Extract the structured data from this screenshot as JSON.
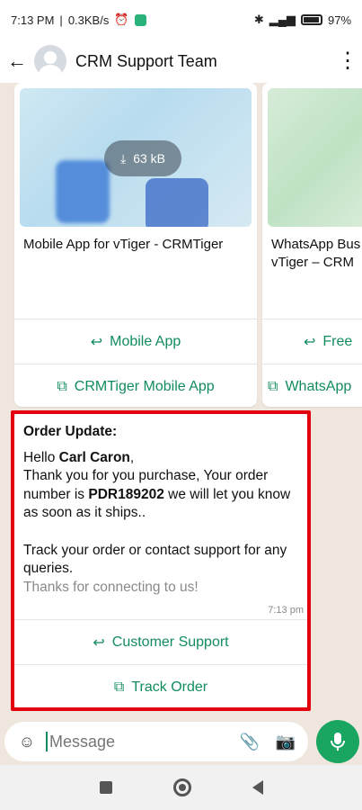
{
  "status": {
    "time": "7:13 PM",
    "speed": "0.3KB/s",
    "alarm_icon": "alarm-icon",
    "battery": "97"
  },
  "header": {
    "title": "CRM Support Team"
  },
  "cards": [
    {
      "size_label": "63 kB",
      "text": "Mobile App for vTiger - CRMTiger",
      "reply_button": "Mobile App",
      "link_button": "CRMTiger Mobile App"
    },
    {
      "text": "WhatsApp Bus for vTiger – CRM",
      "reply_button": "Free",
      "link_button": "WhatsApp"
    }
  ],
  "message": {
    "heading": "Order Update:",
    "greeting": "Hello ",
    "name": "Carl Caron",
    "comma": ",",
    "line1": "Thank you for you purchase, Your order number is ",
    "order_no": "PDR189202",
    "line1_end": " we will let you know as soon as it ships..",
    "line2": "Track your order or contact support for any queries.",
    "thanks": "Thanks for connecting to us!",
    "time": "7:13 pm",
    "reply_button": "Customer Support",
    "link_button": "Track Order"
  },
  "composer": {
    "placeholder": "Message"
  },
  "colors": {
    "accent": "#128c5e",
    "highlight_border": "#e3000f",
    "mic": "#1aa561"
  }
}
